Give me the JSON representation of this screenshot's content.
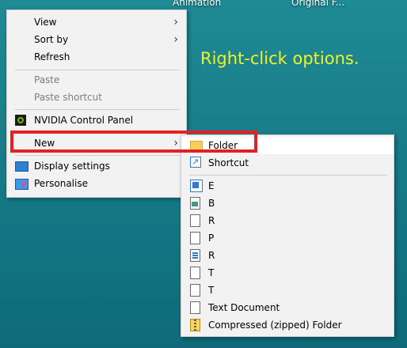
{
  "desktop": {
    "icon_label_1": "Animation",
    "icon_label_2": "Original F..."
  },
  "annotation": "Right-click options.",
  "context_menu": {
    "items": [
      {
        "label": "View",
        "submenu": true
      },
      {
        "label": "Sort by",
        "submenu": true
      },
      {
        "label": "Refresh"
      },
      {
        "label": "Paste",
        "disabled": true
      },
      {
        "label": "Paste shortcut",
        "disabled": true
      },
      {
        "label": "NVIDIA Control Panel",
        "icon": "nvidia-icon"
      },
      {
        "label": "New",
        "submenu": true
      },
      {
        "label": "Display settings",
        "icon": "display-icon"
      },
      {
        "label": "Personalise",
        "icon": "personalise-icon"
      }
    ]
  },
  "new_submenu": {
    "items": [
      {
        "label": "Folder",
        "icon": "folder-icon"
      },
      {
        "label": "Shortcut",
        "icon": "shortcut-icon"
      },
      {
        "label": "E",
        "icon": "access-icon"
      },
      {
        "label": "B",
        "icon": "bitmap-icon"
      },
      {
        "label": "R",
        "icon": "document-icon"
      },
      {
        "label": "P",
        "icon": "document-icon"
      },
      {
        "label": "R",
        "icon": "contact-icon"
      },
      {
        "label": "T",
        "icon": "document-icon"
      },
      {
        "label": "T",
        "icon": "document-icon"
      },
      {
        "label": "Text Document",
        "icon": "text-document-icon"
      },
      {
        "label": "Compressed (zipped) Folder",
        "icon": "zip-folder-icon"
      }
    ]
  },
  "colors": {
    "highlight_border": "#e32028",
    "annotation_text": "#f2f224",
    "menu_background": "#f2f2f2"
  }
}
